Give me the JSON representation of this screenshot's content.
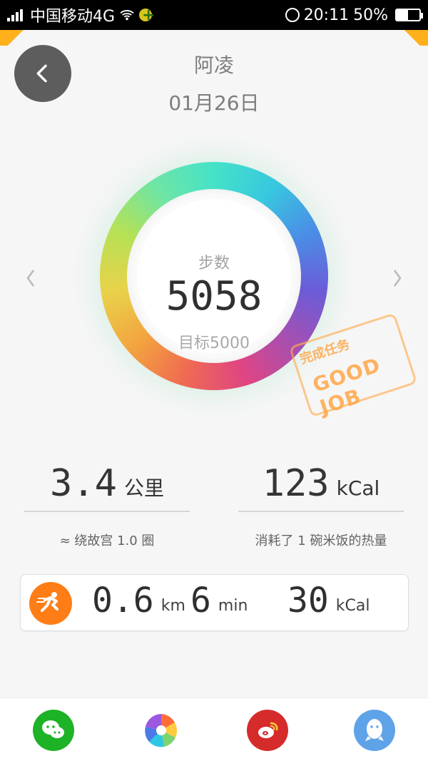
{
  "status_bar": {
    "carrier": "中国移动4G",
    "time": "20:11",
    "battery": "50%",
    "battery_level": 0.5
  },
  "header": {
    "title": "阿凌",
    "date": "01月26日"
  },
  "ring": {
    "label": "步数",
    "value": "5058",
    "goal": "目标5000"
  },
  "stamp": {
    "title": "完成任务",
    "sub": "GOOD JOB"
  },
  "metrics": [
    {
      "value": "3.4",
      "unit": "公里",
      "note": "≈ 绕故宫 1.0 圈"
    },
    {
      "value": "123",
      "unit": "kCal",
      "note": "消耗了 1 碗米饭的热量"
    }
  ],
  "activity": {
    "distance": "0.6",
    "distance_unit": "km",
    "time": "6",
    "time_unit": "min",
    "calories": "30",
    "calories_unit": "kCal"
  },
  "bottom_bar": {
    "wechat": "wechat-icon",
    "moments": "moments-icon",
    "weibo": "weibo-icon",
    "qq": "qq-icon"
  }
}
